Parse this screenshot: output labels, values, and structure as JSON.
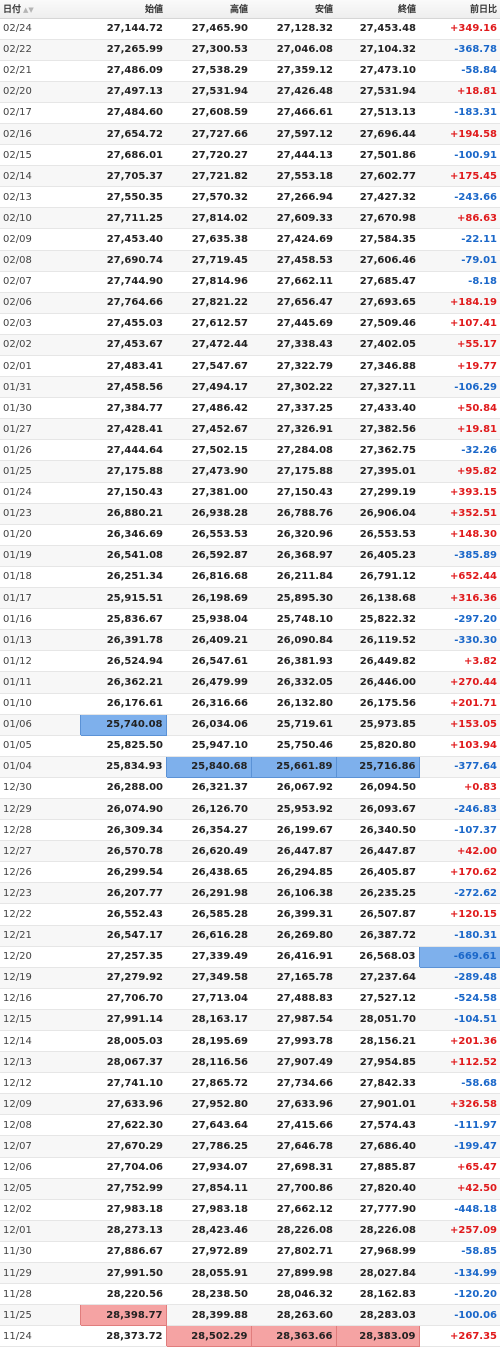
{
  "header": {
    "date": "日付",
    "sort_icon": "▲▼",
    "open": "始値",
    "high": "高値",
    "low": "安値",
    "close": "終値",
    "change": "前日比"
  },
  "colors": {
    "positive": "#e0191b",
    "negative": "#1a67c9",
    "highlight_blue": "#7eb0ec",
    "highlight_red": "#f5a3a3"
  },
  "rows": [
    {
      "date": "02/24",
      "open": "27,144.72",
      "high": "27,465.90",
      "low": "27,128.32",
      "close": "27,453.48",
      "change": "+349.16"
    },
    {
      "date": "02/22",
      "open": "27,265.99",
      "high": "27,300.53",
      "low": "27,046.08",
      "close": "27,104.32",
      "change": "-368.78"
    },
    {
      "date": "02/21",
      "open": "27,486.09",
      "high": "27,538.29",
      "low": "27,359.12",
      "close": "27,473.10",
      "change": "-58.84"
    },
    {
      "date": "02/20",
      "open": "27,497.13",
      "high": "27,531.94",
      "low": "27,426.48",
      "close": "27,531.94",
      "change": "+18.81"
    },
    {
      "date": "02/17",
      "open": "27,484.60",
      "high": "27,608.59",
      "low": "27,466.61",
      "close": "27,513.13",
      "change": "-183.31"
    },
    {
      "date": "02/16",
      "open": "27,654.72",
      "high": "27,727.66",
      "low": "27,597.12",
      "close": "27,696.44",
      "change": "+194.58"
    },
    {
      "date": "02/15",
      "open": "27,686.01",
      "high": "27,720.27",
      "low": "27,444.13",
      "close": "27,501.86",
      "change": "-100.91"
    },
    {
      "date": "02/14",
      "open": "27,705.37",
      "high": "27,721.82",
      "low": "27,553.18",
      "close": "27,602.77",
      "change": "+175.45"
    },
    {
      "date": "02/13",
      "open": "27,550.35",
      "high": "27,570.32",
      "low": "27,266.94",
      "close": "27,427.32",
      "change": "-243.66"
    },
    {
      "date": "02/10",
      "open": "27,711.25",
      "high": "27,814.02",
      "low": "27,609.33",
      "close": "27,670.98",
      "change": "+86.63"
    },
    {
      "date": "02/09",
      "open": "27,453.40",
      "high": "27,635.38",
      "low": "27,424.69",
      "close": "27,584.35",
      "change": "-22.11"
    },
    {
      "date": "02/08",
      "open": "27,690.74",
      "high": "27,719.45",
      "low": "27,458.53",
      "close": "27,606.46",
      "change": "-79.01"
    },
    {
      "date": "02/07",
      "open": "27,744.90",
      "high": "27,814.96",
      "low": "27,662.11",
      "close": "27,685.47",
      "change": "-8.18"
    },
    {
      "date": "02/06",
      "open": "27,764.66",
      "high": "27,821.22",
      "low": "27,656.47",
      "close": "27,693.65",
      "change": "+184.19"
    },
    {
      "date": "02/03",
      "open": "27,455.03",
      "high": "27,612.57",
      "low": "27,445.69",
      "close": "27,509.46",
      "change": "+107.41"
    },
    {
      "date": "02/02",
      "open": "27,453.67",
      "high": "27,472.44",
      "low": "27,338.43",
      "close": "27,402.05",
      "change": "+55.17"
    },
    {
      "date": "02/01",
      "open": "27,483.41",
      "high": "27,547.67",
      "low": "27,322.79",
      "close": "27,346.88",
      "change": "+19.77"
    },
    {
      "date": "01/31",
      "open": "27,458.56",
      "high": "27,494.17",
      "low": "27,302.22",
      "close": "27,327.11",
      "change": "-106.29"
    },
    {
      "date": "01/30",
      "open": "27,384.77",
      "high": "27,486.42",
      "low": "27,337.25",
      "close": "27,433.40",
      "change": "+50.84"
    },
    {
      "date": "01/27",
      "open": "27,428.41",
      "high": "27,452.67",
      "low": "27,326.91",
      "close": "27,382.56",
      "change": "+19.81"
    },
    {
      "date": "01/26",
      "open": "27,444.64",
      "high": "27,502.15",
      "low": "27,284.08",
      "close": "27,362.75",
      "change": "-32.26"
    },
    {
      "date": "01/25",
      "open": "27,175.88",
      "high": "27,473.90",
      "low": "27,175.88",
      "close": "27,395.01",
      "change": "+95.82"
    },
    {
      "date": "01/24",
      "open": "27,150.43",
      "high": "27,381.00",
      "low": "27,150.43",
      "close": "27,299.19",
      "change": "+393.15"
    },
    {
      "date": "01/23",
      "open": "26,880.21",
      "high": "26,938.28",
      "low": "26,788.76",
      "close": "26,906.04",
      "change": "+352.51"
    },
    {
      "date": "01/20",
      "open": "26,346.69",
      "high": "26,553.53",
      "low": "26,320.96",
      "close": "26,553.53",
      "change": "+148.30"
    },
    {
      "date": "01/19",
      "open": "26,541.08",
      "high": "26,592.87",
      "low": "26,368.97",
      "close": "26,405.23",
      "change": "-385.89"
    },
    {
      "date": "01/18",
      "open": "26,251.34",
      "high": "26,816.68",
      "low": "26,211.84",
      "close": "26,791.12",
      "change": "+652.44"
    },
    {
      "date": "01/17",
      "open": "25,915.51",
      "high": "26,198.69",
      "low": "25,895.30",
      "close": "26,138.68",
      "change": "+316.36"
    },
    {
      "date": "01/16",
      "open": "25,836.67",
      "high": "25,938.04",
      "low": "25,748.10",
      "close": "25,822.32",
      "change": "-297.20"
    },
    {
      "date": "01/13",
      "open": "26,391.78",
      "high": "26,409.21",
      "low": "26,090.84",
      "close": "26,119.52",
      "change": "-330.30"
    },
    {
      "date": "01/12",
      "open": "26,524.94",
      "high": "26,547.61",
      "low": "26,381.93",
      "close": "26,449.82",
      "change": "+3.82"
    },
    {
      "date": "01/11",
      "open": "26,362.21",
      "high": "26,479.99",
      "low": "26,332.05",
      "close": "26,446.00",
      "change": "+270.44"
    },
    {
      "date": "01/10",
      "open": "26,176.61",
      "high": "26,316.66",
      "low": "26,132.80",
      "close": "26,175.56",
      "change": "+201.71"
    },
    {
      "date": "01/06",
      "open": "25,740.08",
      "high": "26,034.06",
      "low": "25,719.61",
      "close": "25,973.85",
      "change": "+153.05"
    },
    {
      "date": "01/05",
      "open": "25,825.50",
      "high": "25,947.10",
      "low": "25,750.46",
      "close": "25,820.80",
      "change": "+103.94"
    },
    {
      "date": "01/04",
      "open": "25,834.93",
      "high": "25,840.68",
      "low": "25,661.89",
      "close": "25,716.86",
      "change": "-377.64"
    },
    {
      "date": "12/30",
      "open": "26,288.00",
      "high": "26,321.37",
      "low": "26,067.92",
      "close": "26,094.50",
      "change": "+0.83"
    },
    {
      "date": "12/29",
      "open": "26,074.90",
      "high": "26,126.70",
      "low": "25,953.92",
      "close": "26,093.67",
      "change": "-246.83"
    },
    {
      "date": "12/28",
      "open": "26,309.34",
      "high": "26,354.27",
      "low": "26,199.67",
      "close": "26,340.50",
      "change": "-107.37"
    },
    {
      "date": "12/27",
      "open": "26,570.78",
      "high": "26,620.49",
      "low": "26,447.87",
      "close": "26,447.87",
      "change": "+42.00"
    },
    {
      "date": "12/26",
      "open": "26,299.54",
      "high": "26,438.65",
      "low": "26,294.85",
      "close": "26,405.87",
      "change": "+170.62"
    },
    {
      "date": "12/23",
      "open": "26,207.77",
      "high": "26,291.98",
      "low": "26,106.38",
      "close": "26,235.25",
      "change": "-272.62"
    },
    {
      "date": "12/22",
      "open": "26,552.43",
      "high": "26,585.28",
      "low": "26,399.31",
      "close": "26,507.87",
      "change": "+120.15"
    },
    {
      "date": "12/21",
      "open": "26,547.17",
      "high": "26,616.28",
      "low": "26,269.80",
      "close": "26,387.72",
      "change": "-180.31"
    },
    {
      "date": "12/20",
      "open": "27,257.35",
      "high": "27,339.49",
      "low": "26,416.91",
      "close": "26,568.03",
      "change": "-669.61"
    },
    {
      "date": "12/19",
      "open": "27,279.92",
      "high": "27,349.58",
      "low": "27,165.78",
      "close": "27,237.64",
      "change": "-289.48"
    },
    {
      "date": "12/16",
      "open": "27,706.70",
      "high": "27,713.04",
      "low": "27,488.83",
      "close": "27,527.12",
      "change": "-524.58"
    },
    {
      "date": "12/15",
      "open": "27,991.14",
      "high": "28,163.17",
      "low": "27,987.54",
      "close": "28,051.70",
      "change": "-104.51"
    },
    {
      "date": "12/14",
      "open": "28,005.03",
      "high": "28,195.69",
      "low": "27,993.78",
      "close": "28,156.21",
      "change": "+201.36"
    },
    {
      "date": "12/13",
      "open": "28,067.37",
      "high": "28,116.56",
      "low": "27,907.49",
      "close": "27,954.85",
      "change": "+112.52"
    },
    {
      "date": "12/12",
      "open": "27,741.10",
      "high": "27,865.72",
      "low": "27,734.66",
      "close": "27,842.33",
      "change": "-58.68"
    },
    {
      "date": "12/09",
      "open": "27,633.96",
      "high": "27,952.80",
      "low": "27,633.96",
      "close": "27,901.01",
      "change": "+326.58"
    },
    {
      "date": "12/08",
      "open": "27,622.30",
      "high": "27,643.64",
      "low": "27,415.66",
      "close": "27,574.43",
      "change": "-111.97"
    },
    {
      "date": "12/07",
      "open": "27,670.29",
      "high": "27,786.25",
      "low": "27,646.78",
      "close": "27,686.40",
      "change": "-199.47"
    },
    {
      "date": "12/06",
      "open": "27,704.06",
      "high": "27,934.07",
      "low": "27,698.31",
      "close": "27,885.87",
      "change": "+65.47"
    },
    {
      "date": "12/05",
      "open": "27,752.99",
      "high": "27,854.11",
      "low": "27,700.86",
      "close": "27,820.40",
      "change": "+42.50"
    },
    {
      "date": "12/02",
      "open": "27,983.18",
      "high": "27,983.18",
      "low": "27,662.12",
      "close": "27,777.90",
      "change": "-448.18"
    },
    {
      "date": "12/01",
      "open": "28,273.13",
      "high": "28,423.46",
      "low": "28,226.08",
      "close": "28,226.08",
      "change": "+257.09"
    },
    {
      "date": "11/30",
      "open": "27,886.67",
      "high": "27,972.89",
      "low": "27,802.71",
      "close": "27,968.99",
      "change": "-58.85"
    },
    {
      "date": "11/29",
      "open": "27,991.50",
      "high": "28,055.91",
      "low": "27,899.98",
      "close": "28,027.84",
      "change": "-134.99"
    },
    {
      "date": "11/28",
      "open": "28,220.56",
      "high": "28,238.50",
      "low": "28,046.32",
      "close": "28,162.83",
      "change": "-120.20"
    },
    {
      "date": "11/25",
      "open": "28,398.77",
      "high": "28,399.88",
      "low": "28,263.60",
      "close": "28,283.03",
      "change": "-100.06"
    },
    {
      "date": "11/24",
      "open": "28,373.72",
      "high": "28,502.29",
      "low": "28,363.66",
      "close": "28,383.09",
      "change": "+267.35"
    }
  ],
  "highlights": {
    "01/06": {
      "open": "blue"
    },
    "01/04": {
      "high": "blue",
      "low": "blue",
      "close": "blue"
    },
    "12/20": {
      "change": "blue"
    },
    "11/25": {
      "open": "red"
    },
    "11/24": {
      "high": "red",
      "low": "red",
      "close": "red"
    }
  }
}
